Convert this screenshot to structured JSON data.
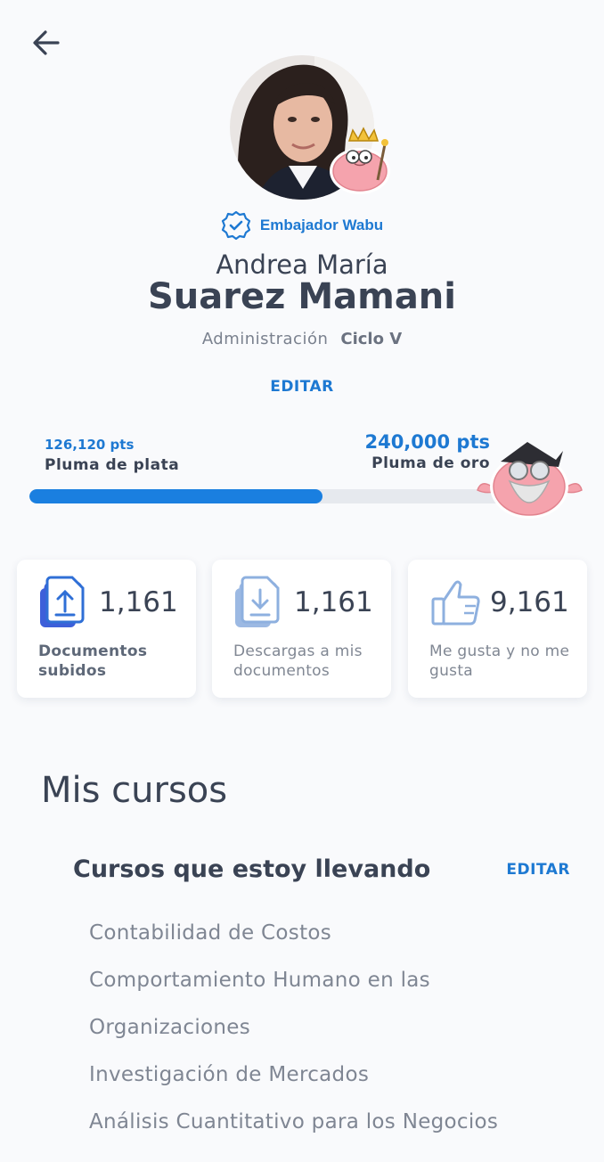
{
  "header": {
    "back_icon": "arrow-left-icon"
  },
  "profile": {
    "badge_label": "Embajador Wabu",
    "first_name": "Andrea María",
    "last_name": "Suarez Mamani",
    "career": "Administración",
    "cycle": "Ciclo V",
    "edit_label": "EDITAR"
  },
  "progress": {
    "current_pts": "126,120 pts",
    "current_level": "Pluma de plata",
    "target_pts": "240,000 pts",
    "target_level": "Pluma de oro",
    "fill_fraction": 0.61
  },
  "stats": [
    {
      "icon": "document-upload-icon",
      "value": "1,161",
      "label": "Documentos subidos"
    },
    {
      "icon": "document-download-icon",
      "value": "1,161",
      "label": "Descargas a mis documentos"
    },
    {
      "icon": "thumbs-up-icon",
      "value": "9,161",
      "label": "Me gusta y no me gusta"
    }
  ],
  "courses": {
    "section_title": "Mis cursos",
    "subtitle": "Cursos que estoy llevando",
    "edit_label": "EDITAR",
    "items": [
      "Contabilidad de Costos",
      "Comportamiento Humano en las",
      "Organizaciones",
      "Investigación de Mercados",
      "Análisis Cuantitativo para los Negocios"
    ]
  },
  "colors": {
    "accent": "#1e79d2",
    "text": "#3a4354",
    "muted": "#7f8693",
    "background": "#f9fafc"
  }
}
